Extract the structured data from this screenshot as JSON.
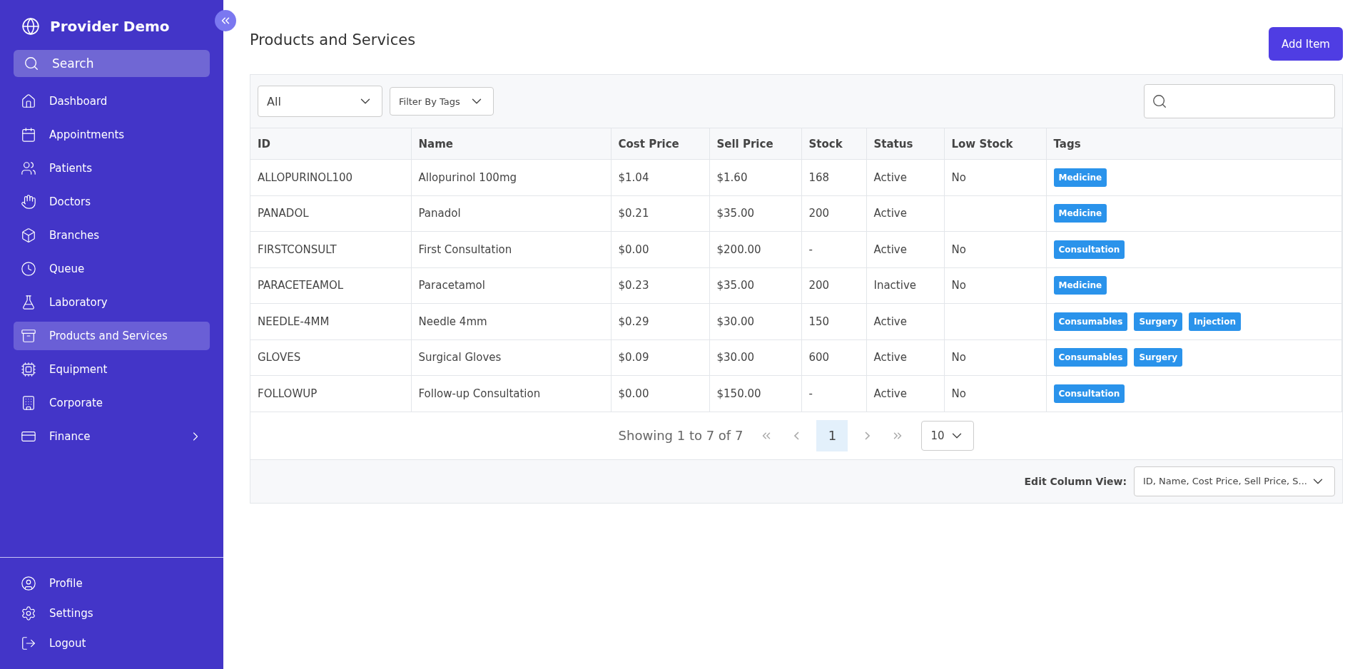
{
  "sidebar": {
    "brand": "Provider Demo",
    "search": {
      "placeholder": "Search"
    },
    "items": [
      {
        "label": "Dashboard",
        "selected": false,
        "expandable": false
      },
      {
        "label": "Appointments",
        "selected": false,
        "expandable": false
      },
      {
        "label": "Patients",
        "selected": false,
        "expandable": false
      },
      {
        "label": "Doctors",
        "selected": false,
        "expandable": false
      },
      {
        "label": "Branches",
        "selected": false,
        "expandable": false
      },
      {
        "label": "Queue",
        "selected": false,
        "expandable": false
      },
      {
        "label": "Laboratory",
        "selected": false,
        "expandable": false
      },
      {
        "label": "Products and Services",
        "selected": true,
        "expandable": false
      },
      {
        "label": "Equipment",
        "selected": false,
        "expandable": false
      },
      {
        "label": "Corporate",
        "selected": false,
        "expandable": false
      },
      {
        "label": "Finance",
        "selected": false,
        "expandable": true
      }
    ],
    "footer_items": [
      {
        "label": "Profile"
      },
      {
        "label": "Settings"
      },
      {
        "label": "Logout"
      }
    ]
  },
  "page": {
    "title": "Products and Services",
    "add_button": "Add Item"
  },
  "filters": {
    "status": "All",
    "tags": {
      "placeholder": "Filter By Tags"
    }
  },
  "table": {
    "columns": [
      "ID",
      "Name",
      "Cost Price",
      "Sell Price",
      "Stock",
      "Status",
      "Low Stock",
      "Tags"
    ],
    "rows": [
      {
        "cells": [
          "ALLOPURINOL100",
          "Allopurinol 100mg",
          "$1.04",
          "$1.60",
          "168",
          "Active",
          "No"
        ],
        "tags": [
          "Medicine"
        ]
      },
      {
        "cells": [
          "PANADOL",
          "Panadol",
          "$0.21",
          "$35.00",
          "200",
          "Active",
          null
        ],
        "tags": [
          "Medicine"
        ]
      },
      {
        "cells": [
          "FIRSTCONSULT",
          "First Consultation",
          "$0.00",
          "$200.00",
          "-",
          "Active",
          "No"
        ],
        "tags": [
          "Consultation"
        ]
      },
      {
        "cells": [
          "PARACETEAMOL",
          "Paracetamol",
          "$0.23",
          "$35.00",
          "200",
          "Inactive",
          "No"
        ],
        "tags": [
          "Medicine"
        ]
      },
      {
        "cells": [
          "NEEDLE-4MM",
          "Needle 4mm",
          "$0.29",
          "$30.00",
          "150",
          "Active",
          null
        ],
        "tags": [
          "Consumables",
          "Surgery",
          "Injection"
        ]
      },
      {
        "cells": [
          "GLOVES",
          "Surgical Gloves",
          "$0.09",
          "$30.00",
          "600",
          "Active",
          "No"
        ],
        "tags": [
          "Consumables",
          "Surgery"
        ]
      },
      {
        "cells": [
          "FOLLOWUP",
          "Follow-up Consultation",
          "$0.00",
          "$150.00",
          "-",
          "Active",
          "No"
        ],
        "tags": [
          "Consultation"
        ]
      }
    ]
  },
  "pagination": {
    "summary": "Showing 1 to 7 of 7",
    "pages": [
      {
        "label": "1",
        "selected": true
      }
    ],
    "page_size": "10"
  },
  "column_view": {
    "label": "Edit Column View:",
    "value": "ID, Name, Cost Price, Sell Price, S..."
  }
}
